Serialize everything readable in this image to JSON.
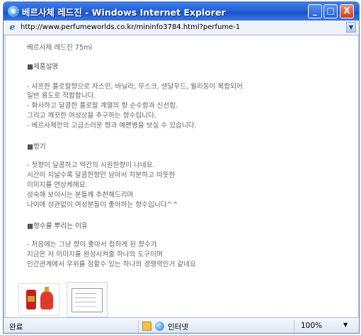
{
  "window": {
    "title": "베르사체 레드진 - Windows Internet Explorer",
    "minimize": "_",
    "maximize": "□",
    "close": "X"
  },
  "address": {
    "icon": "e",
    "url": "http://www.perfumeworlds.co.kr/mininfo3784.html?perfume-1",
    "dropdown": "▼"
  },
  "content": {
    "product_title": "베르사체 레드진 75ml",
    "sections": [
      {
        "heading": "■제품설명",
        "lines": [
          "- 샤프한 플로랄향으로 자스민, 바닐라, 무스크, 샌달우드, 윌리등이 복합되어",
          "  일반 용도로 적합합니다.",
          "- 화사하고 달콤한 플로랄 계열의 향 순수함과 신선함.",
          "  그리고 깨끗한 여성상을 추구하는 향수입니다.",
          "- 베르사체만의 고급스러운 향과 예쁜병을 보실 수 있습니다."
        ]
      },
      {
        "heading": "■향기",
        "lines": [
          "- 첫향이 달콤하고 약간의 시원한향이 나네요.",
          "  시간이 지날수록 달콤한향만 남아서 차분하고 따뜻한",
          "  이미지를 연상케해요.",
          "  성숙해 보이시는 분들께 추천해드리며",
          "  나이에 상관없이 여성분들이 좋아하는 향수입니다^^"
        ]
      },
      {
        "heading": "■향수를 뿌리는 이유",
        "lines": [
          "- 처음에는 그냥 향이 좋아서 접하게 된 향수가",
          "  지금은 저 이미지를 완성시켜줄 하나의 도구이며",
          "  인간관계에서 우위를 점할수 있는 하나의 경쟁력인거 같네요"
        ]
      }
    ]
  },
  "status": {
    "text": "완료",
    "zone": "인터넷",
    "zoom": "100%",
    "zoom_dropdown": "▼"
  },
  "colors": {
    "titlebar": "#2562d9",
    "text": "#666666"
  }
}
